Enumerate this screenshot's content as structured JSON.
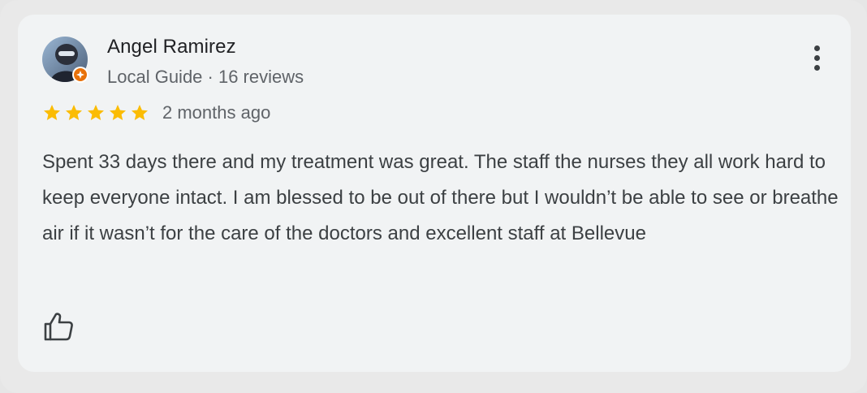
{
  "review": {
    "author_name": "Angel Ramirez",
    "author_meta": "Local Guide · 16 reviews",
    "rating": 5,
    "rating_max": 5,
    "time": "2 months ago",
    "text": "Spent 33 days there and my treatment was great. The staff the nurses they all work hard to keep everyone intact. I am blessed to be out of there but I wouldn’t be able to see or breathe air if it wasn’t for the care of the doctors and excellent staff at Bellevue"
  },
  "icons": {
    "more": "more-vert-icon",
    "like": "thumbs-up-icon",
    "badge": "local-guide-badge-icon",
    "star": "star-icon"
  },
  "colors": {
    "star": "#fbbc04",
    "badge": "#e8710a",
    "card_bg": "#f1f3f4",
    "text": "#3c4043",
    "secondary_text": "#5f6368"
  }
}
